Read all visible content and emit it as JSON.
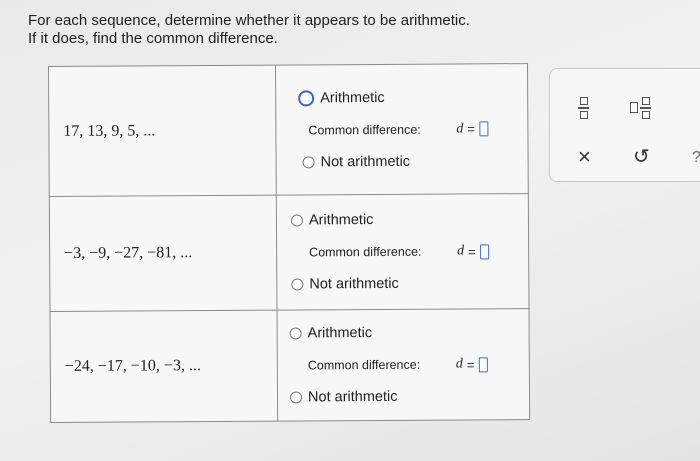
{
  "instructions": {
    "line1": "For each sequence, determine whether it appears to be arithmetic.",
    "line2": "If it does, find the common difference."
  },
  "rows": [
    {
      "sequence": "17, 13, 9, 5, ...",
      "option_arithmetic": "Arithmetic",
      "common_difference_label": "Common difference:",
      "d_symbol": "d",
      "equals": "=",
      "option_not": "Not arithmetic",
      "selected": "arithmetic"
    },
    {
      "sequence": "−3, −9, −27, −81, ...",
      "option_arithmetic": "Arithmetic",
      "common_difference_label": "Common difference:",
      "d_symbol": "d",
      "equals": "=",
      "option_not": "Not arithmetic",
      "selected": "none"
    },
    {
      "sequence": "−24, −17, −10, −3, ...",
      "option_arithmetic": "Arithmetic",
      "common_difference_label": "Common difference:",
      "d_symbol": "d",
      "equals": "=",
      "option_not": "Not arithmetic",
      "selected": "none"
    }
  ],
  "toolbar": {
    "buttons": [
      "fraction-icon",
      "mixed-number-icon",
      "clear-x-icon",
      "undo-icon",
      "help-icon"
    ],
    "clear_glyph": "×",
    "undo_glyph": "↺",
    "help_glyph": "?"
  },
  "colors": {
    "accent": "#3a6ad0",
    "border": "#8a8a8a"
  }
}
